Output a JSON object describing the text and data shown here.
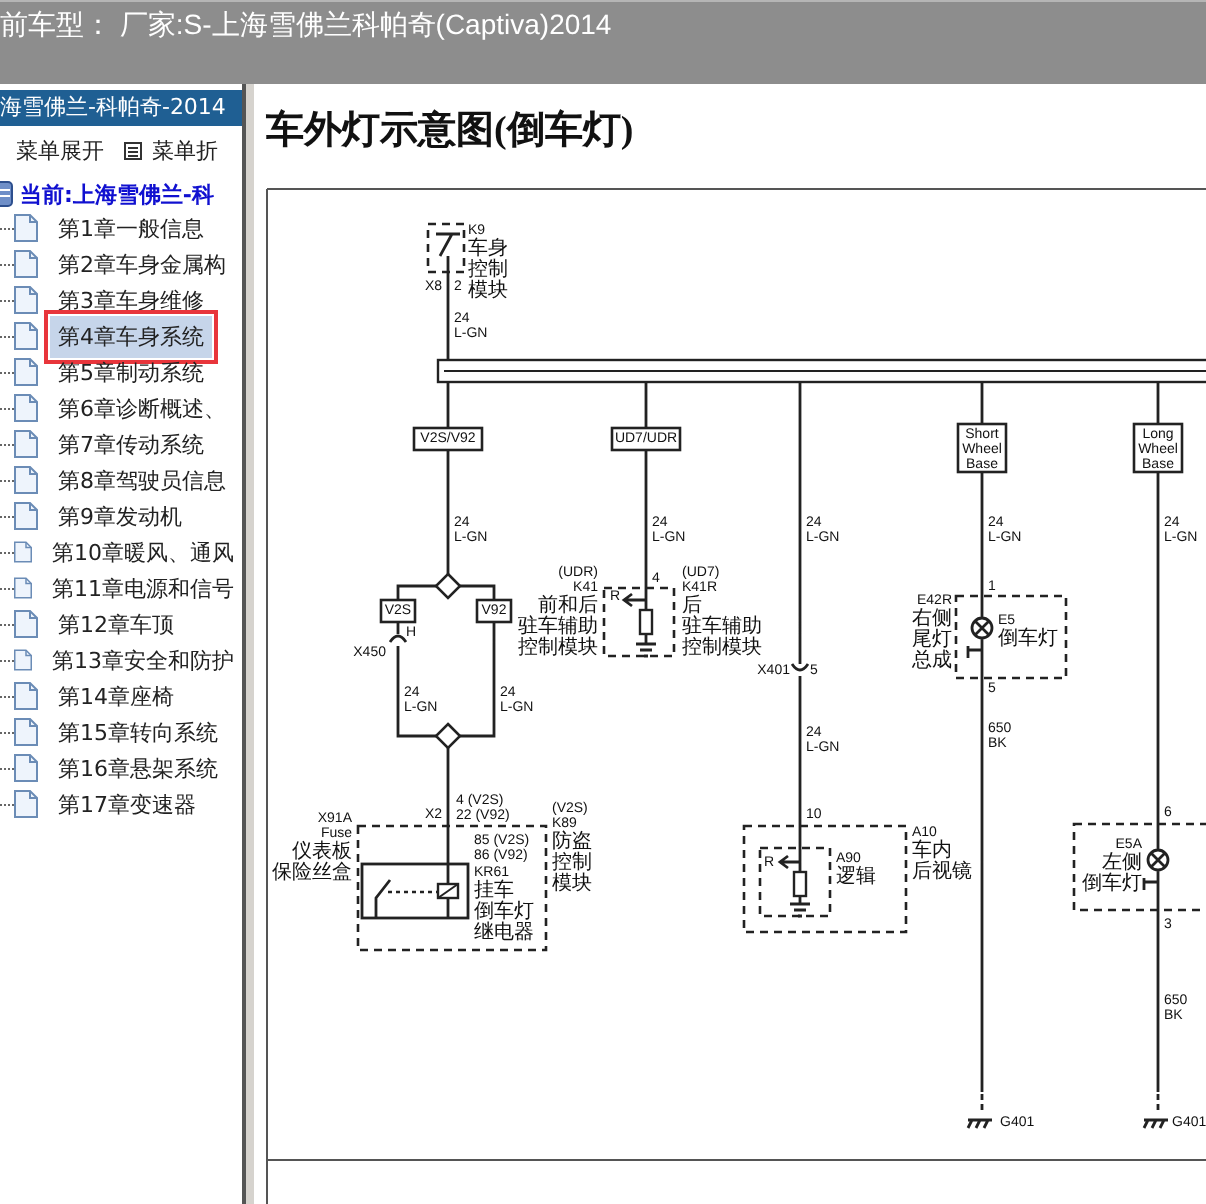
{
  "header": {
    "title": "前车型： 厂家:S-上海雪佛兰科帕奇(Captiva)2014"
  },
  "sidebar": {
    "title": "海雪佛兰-科帕奇-2014",
    "toolbar": [
      {
        "kind": "plain",
        "label": "菜单展开"
      },
      {
        "kind": "icon",
        "label": "菜单折"
      }
    ],
    "root": "当前:上海雪佛兰-科",
    "items": [
      {
        "label": "第1章一般信息",
        "selected": false
      },
      {
        "label": "第2章车身金属构",
        "selected": false
      },
      {
        "label": "第3章车身维修",
        "selected": false
      },
      {
        "label": "第4章车身系统",
        "selected": true
      },
      {
        "label": "第5章制动系统",
        "selected": false
      },
      {
        "label": "第6章诊断概述、",
        "selected": false
      },
      {
        "label": "第7章传动系统",
        "selected": false
      },
      {
        "label": "第8章驾驶员信息",
        "selected": false
      },
      {
        "label": "第9章发动机",
        "selected": false
      },
      {
        "label": "第10章暖风、通风",
        "selected": false
      },
      {
        "label": "第11章电源和信号",
        "selected": false
      },
      {
        "label": "第12章车顶",
        "selected": false
      },
      {
        "label": "第13章安全和防护",
        "selected": false
      },
      {
        "label": "第14章座椅",
        "selected": false
      },
      {
        "label": "第15章转向系统",
        "selected": false
      },
      {
        "label": "第16章悬架系统",
        "selected": false
      },
      {
        "label": "第17章变速器",
        "selected": false
      }
    ]
  },
  "content": {
    "title": "车外灯示意图(倒车灯)",
    "diagram": {
      "labels": [
        {
          "kind": "text",
          "lines": [
            "K9",
            "车身",
            "控制",
            "模块"
          ]
        },
        {
          "kind": "text",
          "lines": [
            "X8"
          ]
        },
        {
          "kind": "text",
          "lines": [
            "2"
          ]
        },
        {
          "kind": "text",
          "lines": [
            "24",
            "L-GN"
          ]
        },
        {
          "kind": "tag",
          "lines": [
            "V2S/V92"
          ]
        },
        {
          "kind": "tag",
          "lines": [
            "UD7/UDR"
          ]
        },
        {
          "kind": "text",
          "lines": [
            "24",
            "L-GN"
          ]
        },
        {
          "kind": "text",
          "lines": [
            "24",
            "L-GN"
          ]
        },
        {
          "kind": "text",
          "lines": [
            "24",
            "L-GN"
          ]
        },
        {
          "kind": "tag",
          "lines": [
            "Short",
            "Wheel",
            "Base"
          ]
        },
        {
          "kind": "tag",
          "lines": [
            "Long",
            "Wheel",
            "Base"
          ]
        },
        {
          "kind": "text",
          "lines": [
            "24",
            "L-GN"
          ]
        },
        {
          "kind": "text",
          "lines": [
            "24",
            "L-GN"
          ]
        },
        {
          "kind": "tag",
          "lines": [
            "V2S"
          ]
        },
        {
          "kind": "tag",
          "lines": [
            "V92"
          ]
        },
        {
          "kind": "text",
          "lines": [
            "(UDR)",
            "K41",
            "前和后",
            "驻车辅助",
            "控制模块"
          ]
        },
        {
          "kind": "text",
          "lines": [
            "4"
          ]
        },
        {
          "kind": "text",
          "lines": [
            "(UD7)",
            "K41R",
            "后",
            "驻车辅助",
            "控制模块"
          ]
        },
        {
          "kind": "text",
          "lines": [
            "X401"
          ]
        },
        {
          "kind": "text",
          "lines": [
            "5"
          ]
        },
        {
          "kind": "text",
          "lines": [
            "H"
          ]
        },
        {
          "kind": "text",
          "lines": [
            "X450"
          ]
        },
        {
          "kind": "text",
          "lines": [
            "24",
            "L-GN"
          ]
        },
        {
          "kind": "text",
          "lines": [
            "24",
            "L-GN"
          ]
        },
        {
          "kind": "text",
          "lines": [
            "24",
            "L-GN"
          ]
        },
        {
          "kind": "text",
          "lines": [
            "E42R",
            "右侧",
            "尾灯",
            "总成"
          ]
        },
        {
          "kind": "text",
          "lines": [
            "1"
          ]
        },
        {
          "kind": "text",
          "lines": [
            "E5",
            "倒车灯"
          ]
        },
        {
          "kind": "text",
          "lines": [
            "5"
          ]
        },
        {
          "kind": "text",
          "lines": [
            "650",
            "BK"
          ]
        },
        {
          "kind": "text",
          "lines": [
            "X2"
          ]
        },
        {
          "kind": "text",
          "lines": [
            "4 (V2S)",
            "22 (V92)"
          ]
        },
        {
          "kind": "text",
          "lines": [
            "X91A",
            "Fuse",
            "仪表板",
            "保险丝盒"
          ]
        },
        {
          "kind": "text",
          "lines": [
            "85 (V2S)",
            "86 (V92)"
          ]
        },
        {
          "kind": "text",
          "lines": [
            "KR61",
            "挂车",
            "倒车灯",
            "继电器"
          ]
        },
        {
          "kind": "text",
          "lines": [
            "(V2S)",
            "K89",
            "防盗",
            "控制",
            "模块"
          ]
        },
        {
          "kind": "text",
          "lines": [
            "10"
          ]
        },
        {
          "kind": "text",
          "lines": [
            "A90",
            "逻辑"
          ]
        },
        {
          "kind": "text",
          "lines": [
            "A10",
            "车内",
            "后视镜"
          ]
        },
        {
          "kind": "text",
          "lines": [
            "R"
          ]
        },
        {
          "kind": "text",
          "lines": [
            "R"
          ]
        },
        {
          "kind": "text",
          "lines": [
            "6"
          ]
        },
        {
          "kind": "text",
          "lines": [
            "E5A",
            "左侧",
            "倒车灯"
          ]
        },
        {
          "kind": "text",
          "lines": [
            "3"
          ]
        },
        {
          "kind": "text",
          "lines": [
            "650",
            "BK"
          ]
        },
        {
          "kind": "text",
          "lines": [
            "G401"
          ]
        },
        {
          "kind": "text",
          "lines": [
            "G401"
          ]
        }
      ]
    }
  }
}
